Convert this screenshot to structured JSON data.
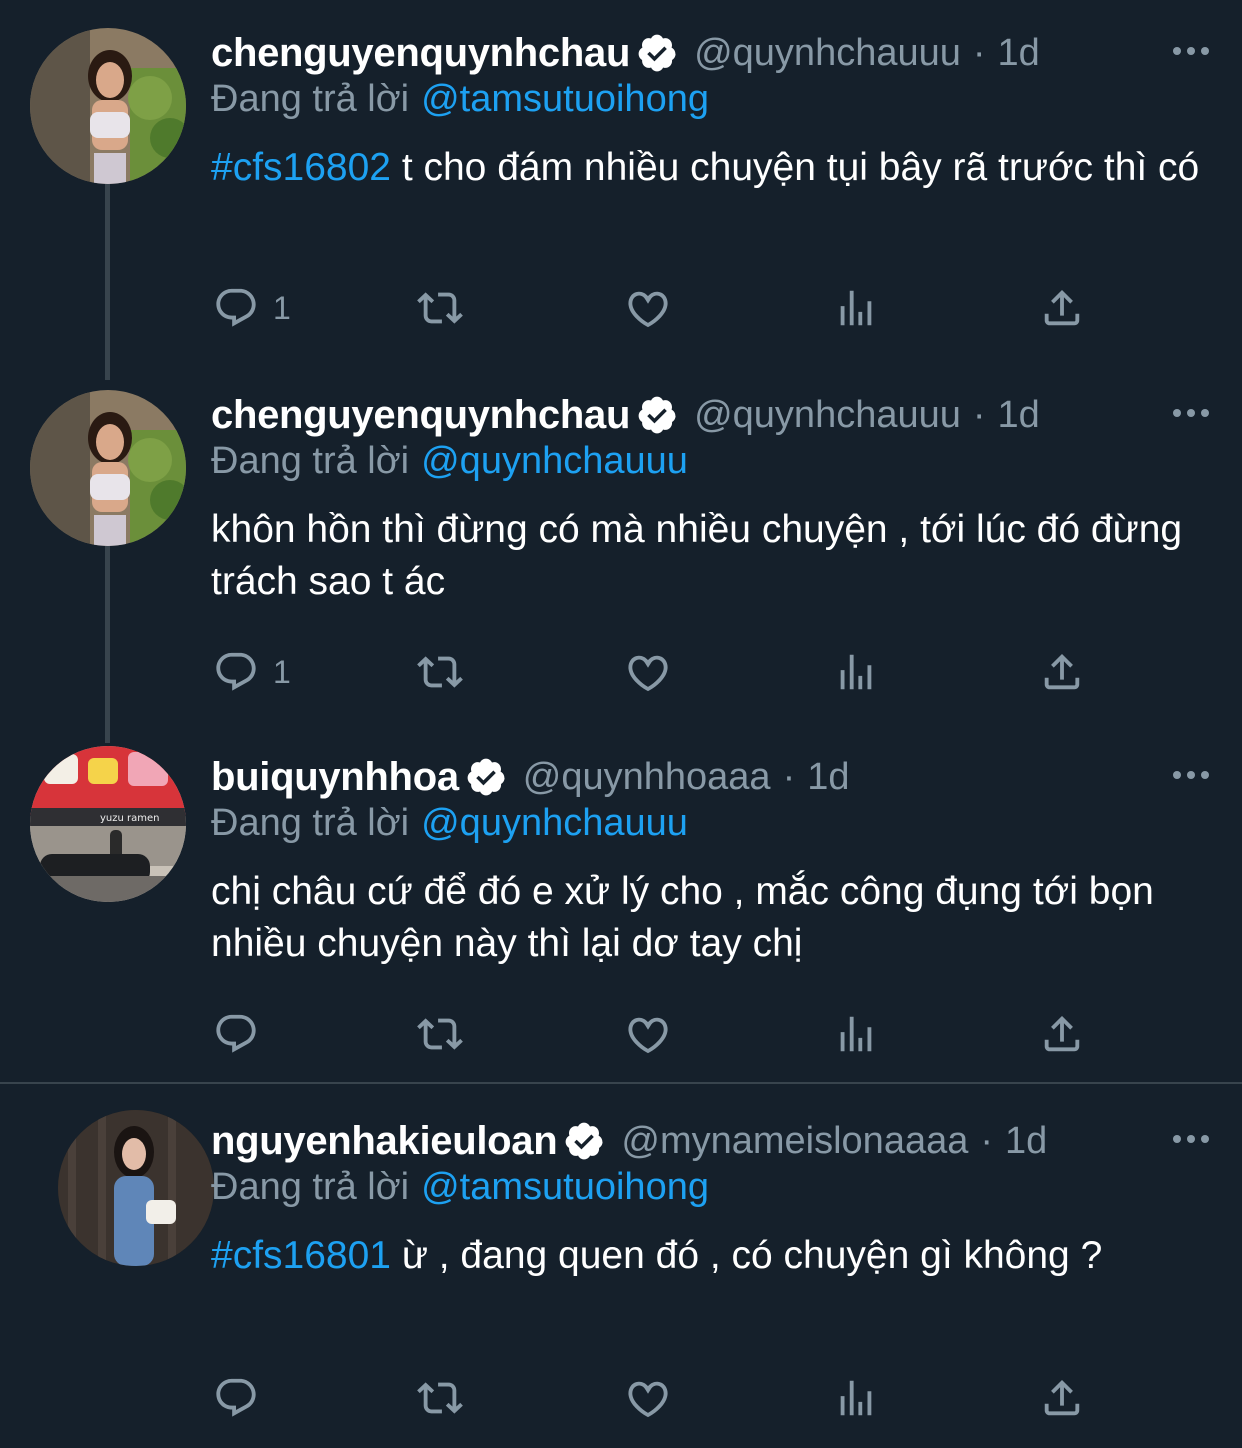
{
  "tweets": [
    {
      "name": "chenguyenquynhchau",
      "handle": "@quynhchauuu",
      "dot": "·",
      "time": "1d",
      "reply_prefix": "Đang trả lời",
      "reply_to": "@tamsutuoihong",
      "hashtag": "#cfs16802",
      "text": " t cho đám nhiều chuyện tụi bây rã trước thì có",
      "reply_count": "1",
      "avatar_icon": "woman-portrait"
    },
    {
      "name": "chenguyenquynhchau",
      "handle": "@quynhchauuu",
      "dot": "·",
      "time": "1d",
      "reply_prefix": "Đang trả lời",
      "reply_to": "@quynhchauuu",
      "hashtag": "",
      "text": "khôn hồn thì đừng có mà nhiều chuyện , tới lúc đó đừng trách sao t ác",
      "reply_count": "1",
      "avatar_icon": "woman-portrait"
    },
    {
      "name": "buiquynhhoa",
      "handle": "@quynhhoaaa",
      "dot": "·",
      "time": "1d",
      "reply_prefix": "Đang trả lời",
      "reply_to": "@quynhchauuu",
      "hashtag": "",
      "text": "chị châu cứ để đó e xử lý cho , mắc công đụng tới bọn nhiều chuyện này thì lại dơ tay chị",
      "reply_count": "",
      "avatar_icon": "street-storefront",
      "avatar_sign": "yuzu ramen"
    },
    {
      "name": "nguyenhakieuloan",
      "handle": "@mynameislonaaaa",
      "dot": "·",
      "time": "1d",
      "reply_prefix": "Đang trả lời",
      "reply_to": "@tamsutuoihong",
      "hashtag": "#cfs16801",
      "text": " ừ , đang quen đó , có chuyện gì không ?",
      "reply_count": "",
      "avatar_icon": "woman-portrait"
    }
  ],
  "colors": {
    "background": "#15202b",
    "accent": "#1da1f2",
    "muted": "#8899a6",
    "divider": "#38444d"
  }
}
